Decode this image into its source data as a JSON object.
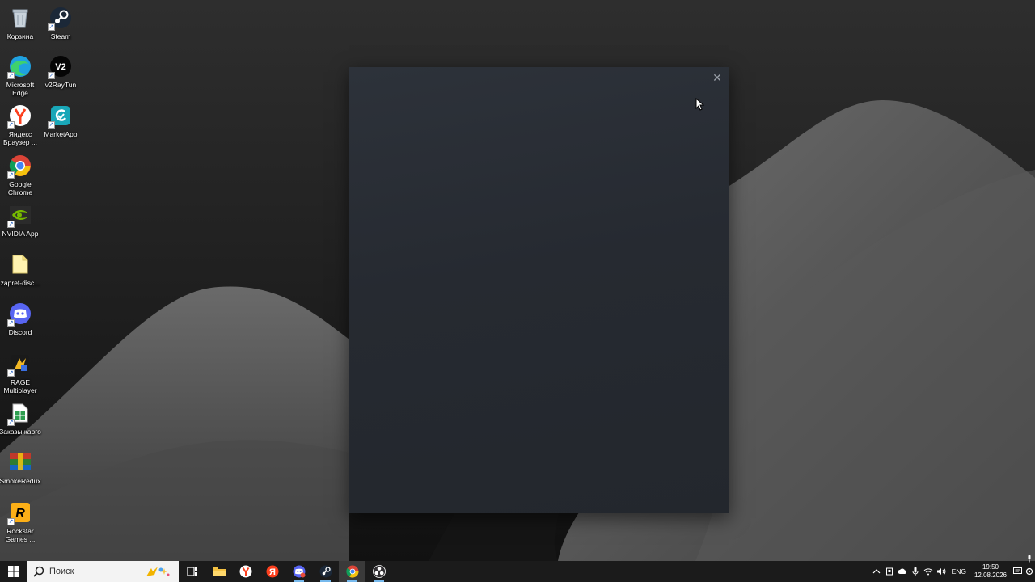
{
  "desktop": {
    "icons": [
      {
        "label": "Корзина",
        "icon": "recycle-bin-icon"
      },
      {
        "label": "Steam",
        "icon": "steam-icon"
      },
      {
        "label": "Microsoft Edge",
        "icon": "edge-icon"
      },
      {
        "label": "v2RayTun",
        "icon": "v2raytun-icon"
      },
      {
        "label": "Яндекс Браузер ...",
        "icon": "yandex-browser-icon"
      },
      {
        "label": "MarketApp",
        "icon": "marketapp-icon"
      },
      {
        "label": "Google Chrome",
        "icon": "chrome-icon"
      },
      {
        "label": "NVIDIA App",
        "icon": "nvidia-icon"
      },
      {
        "label": "zapret-disc...",
        "icon": "folder-icon"
      },
      {
        "label": "Discord",
        "icon": "discord-icon"
      },
      {
        "label": "RAGE Multiplayer",
        "icon": "rage-mp-icon"
      },
      {
        "label": "Заказы карго",
        "icon": "spreadsheet-icon"
      },
      {
        "label": "SmokeRedux",
        "icon": "smokeredux-icon"
      },
      {
        "label": "Rockstar Games ...",
        "icon": "rockstar-icon"
      }
    ],
    "v2_glyph": "V2",
    "rockstar_glyph": "R",
    "yandex_glyph": "Я"
  },
  "dialog": {
    "close_glyph": "✕"
  },
  "taskbar": {
    "search_placeholder": "Поиск",
    "pinned": [
      {
        "name": "task-view",
        "icon": "task-view-icon"
      },
      {
        "name": "file-explorer",
        "icon": "file-explorer-icon"
      },
      {
        "name": "yandex-browser",
        "icon": "yandex-browser-icon"
      },
      {
        "name": "yandex",
        "icon": "yandex-icon"
      },
      {
        "name": "discord",
        "icon": "discord-icon"
      },
      {
        "name": "steam",
        "icon": "steam-icon"
      },
      {
        "name": "chrome",
        "icon": "chrome-icon"
      },
      {
        "name": "obs",
        "icon": "obs-icon"
      }
    ],
    "tray": {
      "language": "ENG",
      "time": "19:50",
      "date": "12.08.2026"
    }
  },
  "colors": {
    "dialog_bg": "#2a2e35",
    "taskbar_bg": "#1b1b1b",
    "accent": "#76b9ed"
  }
}
